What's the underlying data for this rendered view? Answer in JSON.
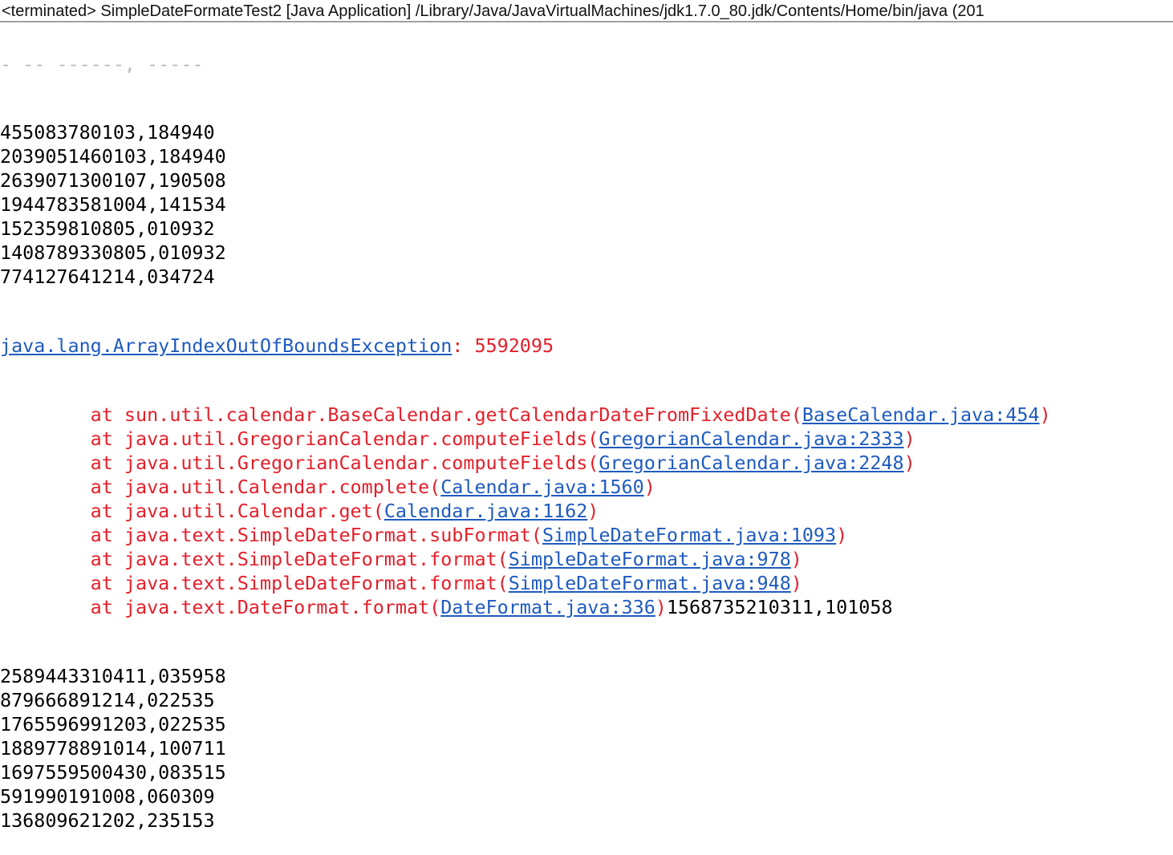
{
  "header": {
    "title": "<terminated> SimpleDateFormateTest2 [Java Application] /Library/Java/JavaVirtualMachines/jdk1.7.0_80.jdk/Contents/Home/bin/java (201"
  },
  "colors": {
    "error": "#e3202b",
    "link": "#1f5bbf",
    "text": "#000000"
  },
  "output_before": [
    "455083780103,184940",
    "2039051460103,184940",
    "2639071300107,190508",
    "1944783581004,141534",
    "152359810805,010932",
    "1408789330805,010932",
    "774127641214,034724"
  ],
  "exception": {
    "type": "java.lang.ArrayIndexOutOfBoundsException",
    "separator": ": ",
    "message": "5592095"
  },
  "stack": [
    {
      "prefix": "\tat sun.util.calendar.BaseCalendar.getCalendarDateFromFixedDate(",
      "link": "BaseCalendar.java:454",
      "suffix": ")"
    },
    {
      "prefix": "\tat java.util.GregorianCalendar.computeFields(",
      "link": "GregorianCalendar.java:2333",
      "suffix": ")"
    },
    {
      "prefix": "\tat java.util.GregorianCalendar.computeFields(",
      "link": "GregorianCalendar.java:2248",
      "suffix": ")"
    },
    {
      "prefix": "\tat java.util.Calendar.complete(",
      "link": "Calendar.java:1560",
      "suffix": ")"
    },
    {
      "prefix": "\tat java.util.Calendar.get(",
      "link": "Calendar.java:1162",
      "suffix": ")"
    },
    {
      "prefix": "\tat java.text.SimpleDateFormat.subFormat(",
      "link": "SimpleDateFormat.java:1093",
      "suffix": ")"
    },
    {
      "prefix": "\tat java.text.SimpleDateFormat.format(",
      "link": "SimpleDateFormat.java:978",
      "suffix": ")"
    },
    {
      "prefix": "\tat java.text.SimpleDateFormat.format(",
      "link": "SimpleDateFormat.java:948",
      "suffix": ")"
    },
    {
      "prefix": "\tat java.text.DateFormat.format(",
      "link": "DateFormat.java:336",
      "suffix": ")",
      "trailing": "1568735210311,101058"
    }
  ],
  "output_after": [
    "2589443310411,035958",
    "879666891214,022535",
    "1765596991203,022535",
    "1889778891014,100711",
    "1697559500430,083515",
    "591990191008,060309",
    "136809621202,235153"
  ]
}
